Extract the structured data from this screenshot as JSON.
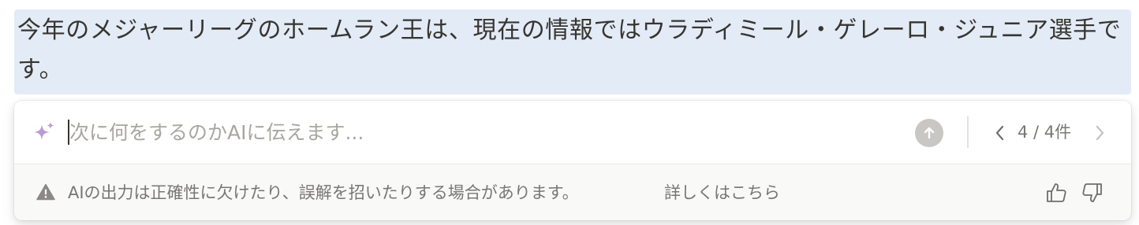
{
  "selection": {
    "text": "今年のメジャーリーグのホームラン王は、現在の情報ではウラディミール・ゲレーロ・ジュニア選手です。"
  },
  "ai_panel": {
    "input": {
      "placeholder": "次に何をするのかAIに伝えます...",
      "value": ""
    },
    "icons": {
      "sparkle": "sparkle-icon",
      "send": "arrow-up-icon",
      "prev": "chevron-left-icon",
      "next": "chevron-right-icon",
      "warning": "warning-triangle-icon",
      "thumbs_up": "thumbs-up-icon",
      "thumbs_down": "thumbs-down-icon"
    },
    "pagination": {
      "label": "4 / 4件"
    },
    "footer": {
      "disclaimer": "AIの出力は正確性に欠けたり、誤解を招いたりする場合があります。",
      "learn_more": "詳しくはこちら"
    }
  },
  "colors": {
    "selection_bg": "#e3ebf7",
    "sparkle_accent": "#a37fc9",
    "muted_text": "#787774",
    "send_button_bg": "#c8c7c4"
  }
}
